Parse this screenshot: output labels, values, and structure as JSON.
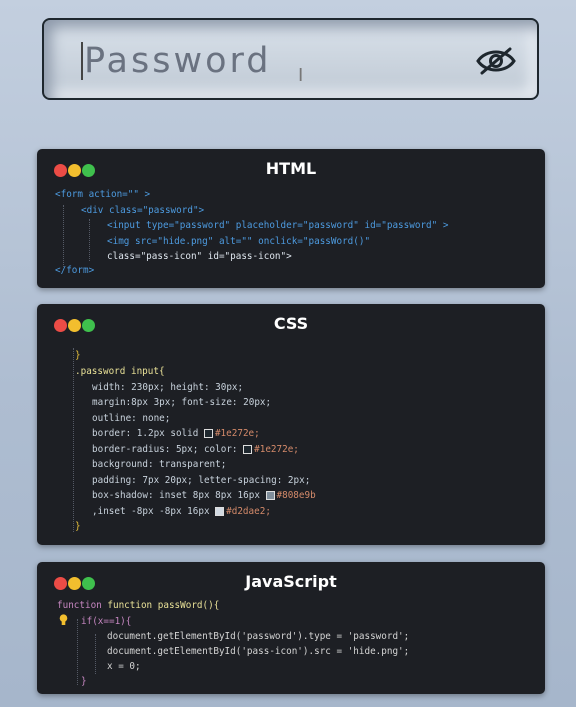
{
  "password_field": {
    "placeholder": "Password",
    "toggle_icon": "eye-slash-icon"
  },
  "html_card": {
    "title": "HTML",
    "lines": {
      "l1": "<form action=\"\" >",
      "l2": "<div class=\"password\">",
      "l3": "<input type=\"password\" placeholder=\"password\" id=\"password\" >",
      "l4": "<img src=\"hide.png\" alt=\"\" onclick=\"passWord()\"",
      "l5": "class=\"pass-icon\" id=\"pass-icon\">",
      "l6": "</form>"
    }
  },
  "css_card": {
    "title": "CSS",
    "lines": {
      "l1": "}",
      "l2": ".password input{",
      "l3": "width: 230px; height: 30px;",
      "l4": "margin:8px 3px; font-size: 20px;",
      "l5": "outline: none;",
      "l6_a": "border: 1.2px solid ",
      "l6_b": "#1e272e;",
      "l7_a": "border-radius: 5px; color: ",
      "l7_b": "#1e272e;",
      "l8": "background: transparent;",
      "l9": "padding: 7px 20px; letter-spacing: 2px;",
      "l10_a": "box-shadow: inset 8px 8px 16px ",
      "l10_b": "#808e9b",
      "l11_a": ",inset -8px -8px 16px ",
      "l11_b": "#d2dae2;",
      "l12": "}"
    },
    "swatches": {
      "s1": "#1e272e",
      "s2": "#1e272e",
      "s3": "#808e9b",
      "s4": "#d2dae2"
    }
  },
  "js_card": {
    "title": "JavaScript",
    "lines": {
      "l1": "function passWord(){",
      "l2": "if(x==1){",
      "l3": "document.getElementById('password').type = 'password';",
      "l4": "document.getElementById('pass-icon').src = 'hide.png';",
      "l5": "x = 0;",
      "l6": "}"
    }
  }
}
